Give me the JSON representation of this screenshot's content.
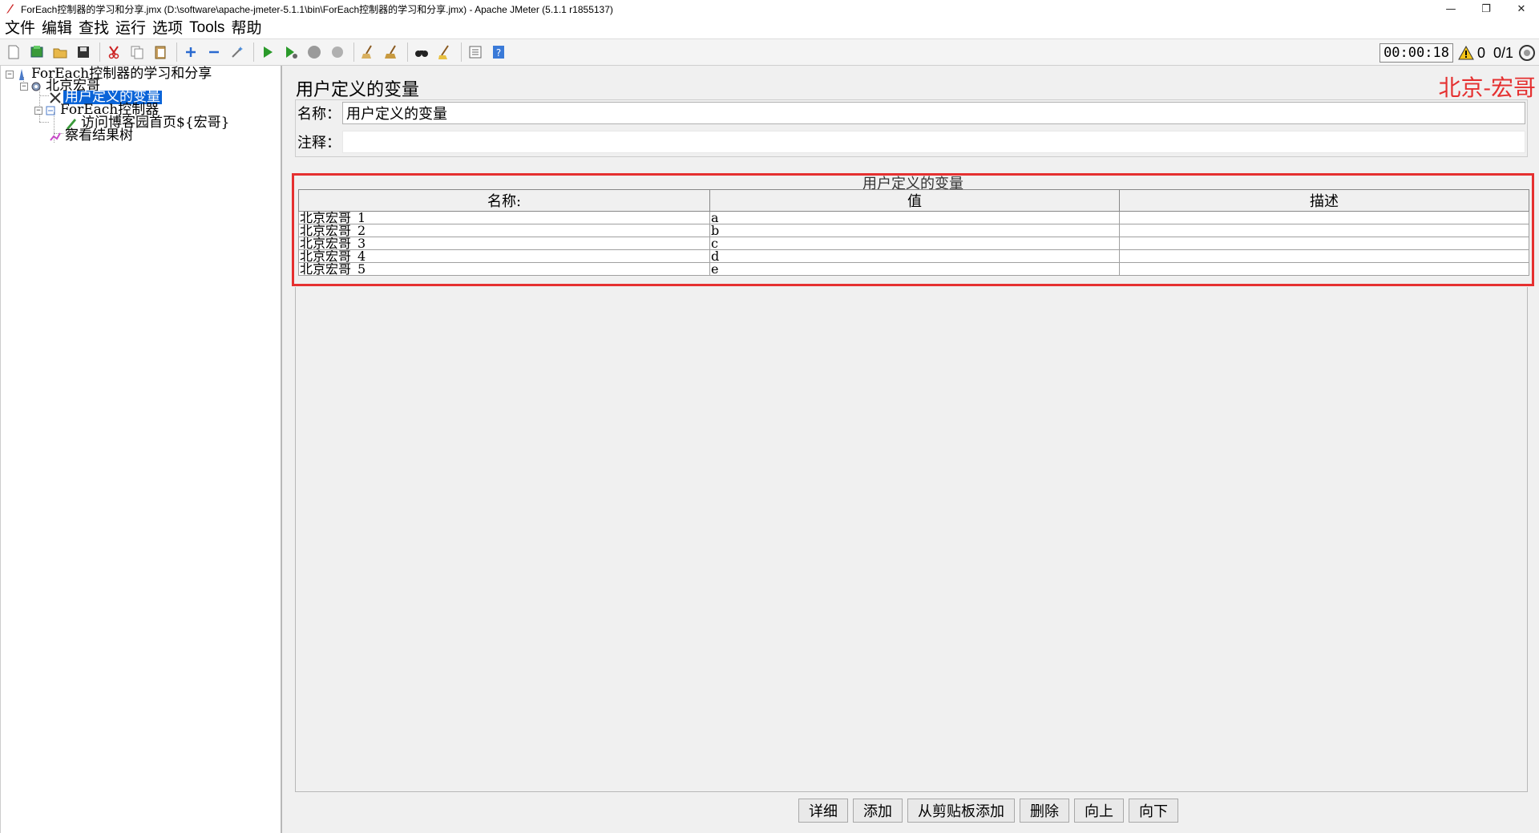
{
  "window": {
    "title": "ForEach控制器的学习和分享.jmx (D:\\software\\apache-jmeter-5.1.1\\bin\\ForEach控制器的学习和分享.jmx) - Apache JMeter (5.1.1 r1855137)",
    "minimize": "—",
    "restore": "❐",
    "close": "✕"
  },
  "menu": {
    "file": "文件",
    "edit": "编辑",
    "search": "查找",
    "run": "运行",
    "options": "选项",
    "tools": "Tools",
    "help": "帮助"
  },
  "toolbar": {
    "timer": "00:00:18",
    "warning_count": "0",
    "threads": "0/1"
  },
  "tree": {
    "nodes": [
      {
        "label": "ForEach控制器的学习和分享",
        "icon": "test-plan-icon"
      },
      {
        "label": "北京宏哥",
        "icon": "thread-group-gear-icon"
      },
      {
        "label": "用户定义的变量",
        "icon": "user-variables-icon"
      },
      {
        "label": "ForEach控制器",
        "icon": "foreach-controller-icon"
      },
      {
        "label": "访问博客园首页${宏哥}",
        "icon": "http-sampler-pen-icon"
      },
      {
        "label": "察看结果树",
        "icon": "results-tree-icon"
      }
    ]
  },
  "panel": {
    "title": "用户定义的变量",
    "watermark": "北京-宏哥",
    "name_label": "名称：",
    "name_value": "用户定义的变量",
    "comment_label": "注释：",
    "comment_value": ""
  },
  "table": {
    "caption": "用户定义的变量",
    "headers": [
      "名称:",
      "值",
      "描述"
    ],
    "rows": [
      [
        "北京宏哥_1",
        "a",
        ""
      ],
      [
        "北京宏哥_2",
        "b",
        ""
      ],
      [
        "北京宏哥_3",
        "c",
        ""
      ],
      [
        "北京宏哥_4",
        "d",
        ""
      ],
      [
        "北京宏哥_5",
        "e",
        ""
      ]
    ]
  },
  "buttons": {
    "detail": "详细",
    "add": "添加",
    "add_from_clipboard": "从剪贴板添加",
    "delete": "删除",
    "up": "向上",
    "down": "向下"
  },
  "colors": {
    "selection": "#0a64d8",
    "highlight_red": "#e53030"
  }
}
